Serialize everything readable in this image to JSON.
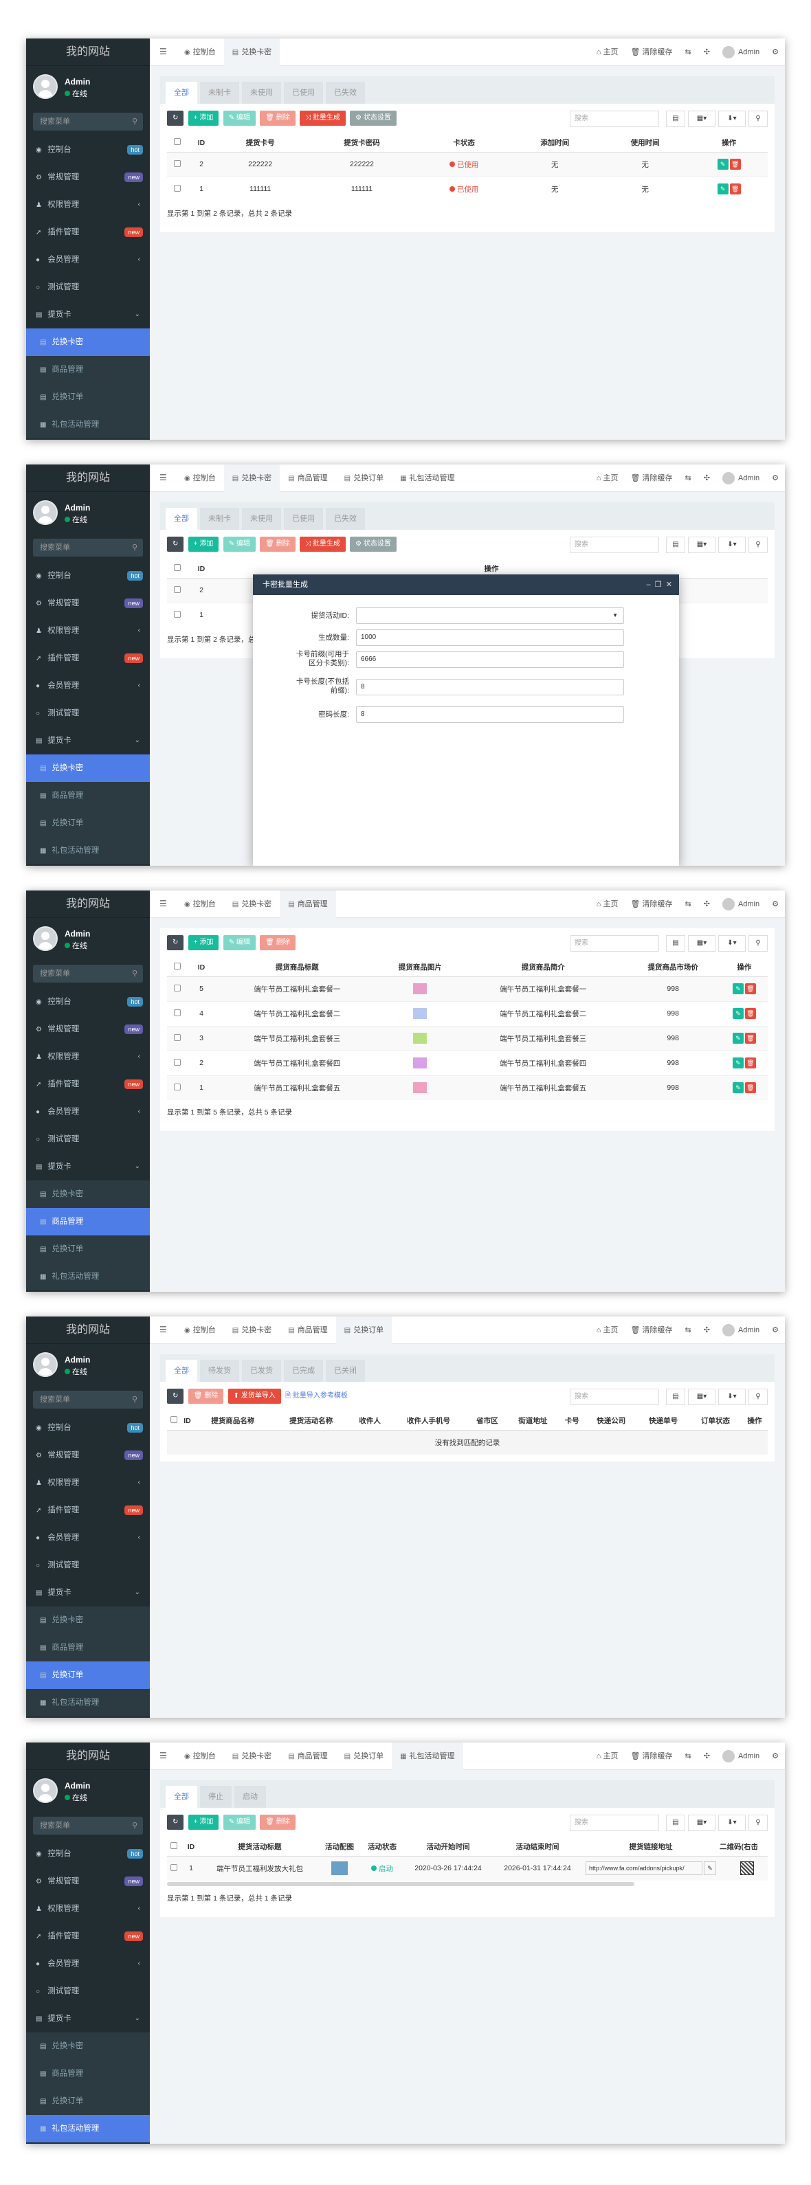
{
  "sidebar": {
    "site_title": "我的网站",
    "user_name": "Admin",
    "user_status": "在线",
    "search_placeholder": "搜索菜单",
    "menu": [
      {
        "label": "控制台",
        "badge": "hot",
        "badge_color": "#3c8dbc"
      },
      {
        "label": "常规管理",
        "badge": "new",
        "badge_color": "#605ca8"
      },
      {
        "label": "权限管理",
        "chevron": "‹"
      },
      {
        "label": "插件管理",
        "badge": "new",
        "badge_color": "#dd4b39"
      },
      {
        "label": "会员管理",
        "chevron": "‹"
      },
      {
        "label": "测试管理"
      },
      {
        "label": "提货卡",
        "chevron": "⌄"
      }
    ],
    "submenu": [
      "兑换卡密",
      "商品管理",
      "兑换订单",
      "礼包活动管理"
    ]
  },
  "topbar": {
    "home": "主页",
    "clear_cache": "清除缓存",
    "admin": "Admin",
    "tab_console": "控制台",
    "tab_card": "兑换卡密",
    "tab_goods": "商品管理",
    "tab_order": "兑换订单",
    "tab_activity": "礼包活动管理"
  },
  "toolbar": {
    "add": "添加",
    "edit": "编辑",
    "delete": "删除",
    "batch_generate": "批量生成",
    "status_set": "状态设置",
    "search_placeholder": "搜索",
    "export_import": "发货单导入",
    "import_template": "批量导入参考模板"
  },
  "screen1": {
    "filter_tabs": [
      "全部",
      "未制卡",
      "未使用",
      "已使用",
      "已失效"
    ],
    "columns": [
      "ID",
      "提货卡号",
      "提货卡密码",
      "卡状态",
      "添加时间",
      "使用时间",
      "操作"
    ],
    "rows": [
      {
        "id": "2",
        "card_no": "222222",
        "card_pwd": "222222",
        "status": "已使用",
        "add_time": "无",
        "use_time": "无"
      },
      {
        "id": "1",
        "card_no": "111111",
        "card_pwd": "111111",
        "status": "已使用",
        "add_time": "无",
        "use_time": "无"
      }
    ],
    "footer": "显示第 1 到第 2 条记录，总共 2 条记录"
  },
  "screen2": {
    "modal_title": "卡密批量生成",
    "fields": [
      {
        "label": "提货活动ID:",
        "value": ""
      },
      {
        "label": "生成数量:",
        "value": "1000"
      },
      {
        "label_line1": "卡号前缀(可用于",
        "label_line2": "区分卡类别):",
        "value": "6666"
      },
      {
        "label_line1": "卡号长度(不包括",
        "label_line2": "前缀):",
        "value": "8"
      },
      {
        "label": "密码长度:",
        "value": "8"
      }
    ]
  },
  "screen3": {
    "columns": [
      "ID",
      "提货商品标题",
      "提货商品图片",
      "提货商品简介",
      "提货商品市场价",
      "操作"
    ],
    "rows": [
      {
        "id": "5",
        "title": "端午节员工福利礼盒套餐一",
        "desc": "端午节员工福利礼盒套餐一",
        "price": "998",
        "thumb": "#e8a0c8"
      },
      {
        "id": "4",
        "title": "端午节员工福利礼盒套餐二",
        "desc": "端午节员工福利礼盒套餐二",
        "price": "998",
        "thumb": "#b8c8f0"
      },
      {
        "id": "3",
        "title": "端午节员工福利礼盒套餐三",
        "desc": "端午节员工福利礼盒套餐三",
        "price": "998",
        "thumb": "#b8e080"
      },
      {
        "id": "2",
        "title": "端午节员工福利礼盒套餐四",
        "desc": "端午节员工福利礼盒套餐四",
        "price": "998",
        "thumb": "#d8a0e8"
      },
      {
        "id": "1",
        "title": "端午节员工福利礼盒套餐五",
        "desc": "端午节员工福利礼盒套餐五",
        "price": "998",
        "thumb": "#f0a0c0"
      }
    ],
    "footer": "显示第 1 到第 5 条记录，总共 5 条记录"
  },
  "screen4": {
    "filter_tabs": [
      "全部",
      "待发货",
      "已发货",
      "已完成",
      "已关闭"
    ],
    "columns": [
      "ID",
      "提货商品名称",
      "提货活动名称",
      "收件人",
      "收件人手机号",
      "省市区",
      "街道地址",
      "卡号",
      "快递公司",
      "快递单号",
      "订单状态",
      "操作"
    ],
    "empty": "没有找到匹配的记录"
  },
  "screen5": {
    "filter_tabs": [
      "全部",
      "停止",
      "启动"
    ],
    "columns": [
      "ID",
      "提货活动标题",
      "活动配图",
      "活动状态",
      "活动开始时间",
      "活动结束时间",
      "提货链接地址",
      "二维码(右击"
    ],
    "row": {
      "id": "1",
      "title": "端午节员工福利发放大礼包",
      "status": "启动",
      "start": "2020-03-26 17:44:24",
      "end": "2026-01-31 17:44:24",
      "url": "http://www.fa.com/addons/pickupk/"
    },
    "footer": "显示第 1 到第 1 条记录，总共 1 条记录"
  }
}
